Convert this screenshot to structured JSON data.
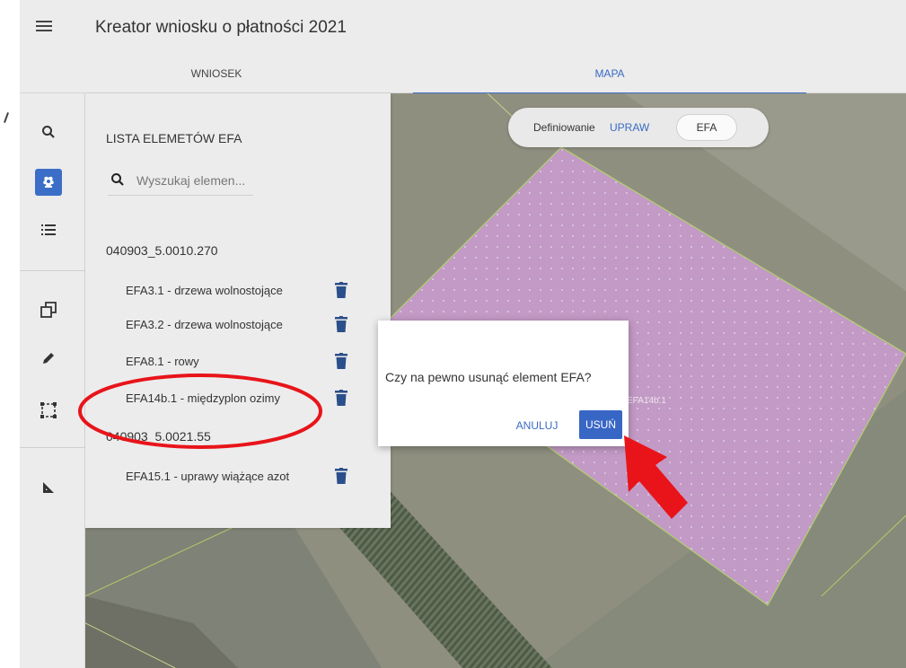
{
  "header": {
    "title": "Kreator wniosku o płatności 2021"
  },
  "tabs": [
    {
      "label": "WNIOSEK",
      "active": false
    },
    {
      "label": "MAPA",
      "active": true
    }
  ],
  "toolbar": {
    "tools": [
      {
        "icon": "search-icon",
        "active": false
      },
      {
        "icon": "plant-icon",
        "active": true
      },
      {
        "icon": "list-icon",
        "active": false
      },
      {
        "icon": "copy-icon",
        "active": false
      },
      {
        "icon": "pencil-icon",
        "active": false
      },
      {
        "icon": "select-area-icon",
        "active": false
      },
      {
        "icon": "measure-icon",
        "active": false
      }
    ]
  },
  "mode_toggle": {
    "label": "Definiowanie",
    "option_upraw": "UPRAW",
    "option_efa": "EFA",
    "selected": "EFA"
  },
  "efa_panel": {
    "title": "LISTA ELEMETÓW EFA",
    "search_placeholder": "Wyszukaj elemen...",
    "groups": [
      {
        "name": "040903_5.0010.270",
        "items": [
          {
            "label": "EFA3.1 - drzewa wolnostojące"
          },
          {
            "label": "EFA3.2 - drzewa wolnostojące"
          },
          {
            "label": "EFA8.1 - rowy"
          },
          {
            "label": "EFA14b.1 - międzyplon ozimy"
          }
        ]
      },
      {
        "name": "040903_5.0021.55",
        "items": [
          {
            "label": "EFA15.1 - uprawy wiążące azot"
          }
        ]
      }
    ]
  },
  "map": {
    "feature_label": "EFA14b.1",
    "polygon_color": "#c49ac8"
  },
  "dialog": {
    "message": "Czy na pewno usunąć element EFA?",
    "cancel_label": "ANULUJ",
    "delete_label": "USUŃ"
  },
  "colors": {
    "accent": "#3a6bc4",
    "annotation": "#e8141a"
  }
}
